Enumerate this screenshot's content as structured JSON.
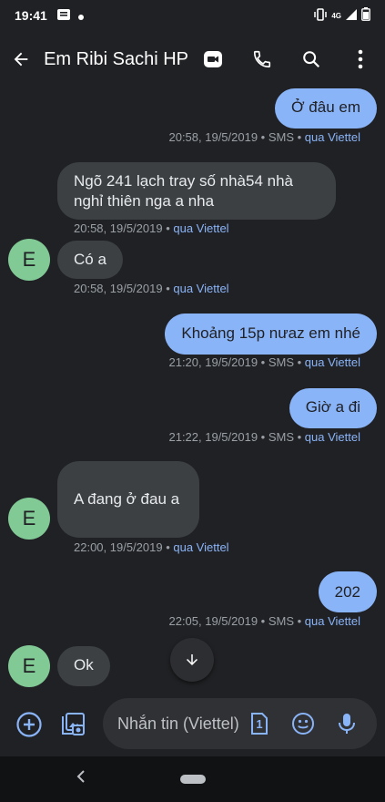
{
  "status": {
    "time": "19:41",
    "network": "4G"
  },
  "header": {
    "title": "Em Ribi Sachi HP"
  },
  "messages": [
    {
      "dir": "out",
      "text": "Ở đâu em",
      "meta": "20:58, 19/5/2019 • SMS • ",
      "via": "qua Viettel"
    },
    {
      "dir": "in",
      "text": "Ngõ 241 lạch tray số nhà54 nhà nghỉ thiên nga a nha",
      "meta": "20:58, 19/5/2019 • ",
      "via": "qua Viettel"
    },
    {
      "dir": "in",
      "text": "Có a",
      "meta": "20:58, 19/5/2019 • ",
      "via": "qua Viettel"
    },
    {
      "dir": "out",
      "text": "Khoảng 15p nưaz em nhé",
      "meta": "21:20, 19/5/2019 • SMS • ",
      "via": "qua Viettel"
    },
    {
      "dir": "out",
      "text": "Giờ a đi",
      "meta": "21:22, 19/5/2019 • SMS • ",
      "via": "qua Viettel"
    },
    {
      "dir": "in",
      "text": "A đang ở đau a",
      "meta": "22:00, 19/5/2019 • ",
      "via": "qua Viettel"
    },
    {
      "dir": "out",
      "text": "202",
      "meta": "22:05, 19/5/2019 • SMS • ",
      "via": "qua Viettel"
    },
    {
      "dir": "in",
      "text": "Ok"
    }
  ],
  "avatar_letter": "E",
  "compose": {
    "placeholder": "Nhắn tin (Viettel)",
    "sim": "1"
  },
  "colors": {
    "outgoing": "#8ab4f8",
    "incoming": "#3c4043",
    "avatar": "#81c995",
    "background": "#202124"
  }
}
